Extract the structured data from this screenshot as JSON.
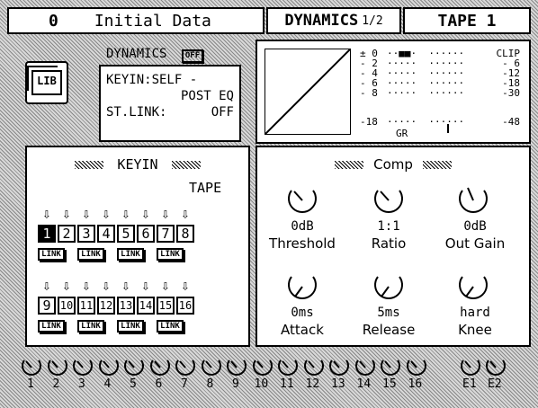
{
  "header": {
    "scene_number": "0",
    "scene_name": "Initial Data",
    "page_title": "DYNAMICS",
    "page_index": "1/2",
    "channel": "TAPE 1"
  },
  "dynamics_panel": {
    "title": "DYNAMICS",
    "status": "OFF",
    "lib_label": "LIB",
    "keyin_line1": "KEYIN:SELF -",
    "keyin_line2": "POST EQ",
    "stlink_label": "ST.LINK:",
    "stlink_value": "OFF"
  },
  "meter": {
    "left_labels": [
      "± 0",
      "- 2",
      "- 4",
      "- 6",
      "- 8",
      "-18"
    ],
    "right_labels": [
      "CLIP",
      "- 6",
      "-12",
      "-18",
      "-30",
      "-48"
    ],
    "gr_label": "GR"
  },
  "keyin": {
    "title": "KEYIN",
    "source": "TAPE",
    "row1": [
      "1",
      "2",
      "3",
      "4",
      "5",
      "6",
      "7",
      "8"
    ],
    "row2": [
      "9",
      "10",
      "11",
      "12",
      "13",
      "14",
      "15",
      "16"
    ],
    "link_label": "LINK",
    "selected": "1"
  },
  "comp": {
    "title": "Comp",
    "knobs": [
      {
        "value": "0dB",
        "label": "Threshold"
      },
      {
        "value": "1:1",
        "label": "Ratio"
      },
      {
        "value": "0dB",
        "label": "Out Gain"
      },
      {
        "value": "0ms",
        "label": "Attack"
      },
      {
        "value": "5ms",
        "label": "Release"
      },
      {
        "value": "hard",
        "label": "Knee"
      }
    ]
  },
  "bottom_knobs": [
    "1",
    "2",
    "3",
    "4",
    "5",
    "6",
    "7",
    "8",
    "9",
    "10",
    "11",
    "12",
    "13",
    "14",
    "15",
    "16",
    "E1",
    "E2"
  ]
}
